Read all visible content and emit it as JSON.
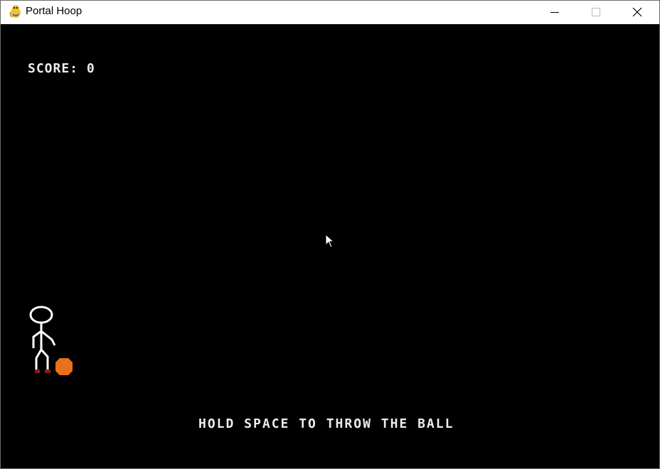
{
  "window": {
    "title": "Portal Hoop",
    "app_icon": "pygame-snake-icon",
    "controls": {
      "minimize_icon": "minimize-icon",
      "maximize_icon": "maximize-icon",
      "close_icon": "close-icon"
    }
  },
  "game": {
    "background": "#000000",
    "score_text": "SCORE: 0",
    "instruction_text": "HOLD SPACE TO THROW THE BALL",
    "text_color": "#ececec",
    "ball_color": "#e8711c",
    "shoe_color": "#8b1a1a",
    "player_color": "#ffffff"
  }
}
